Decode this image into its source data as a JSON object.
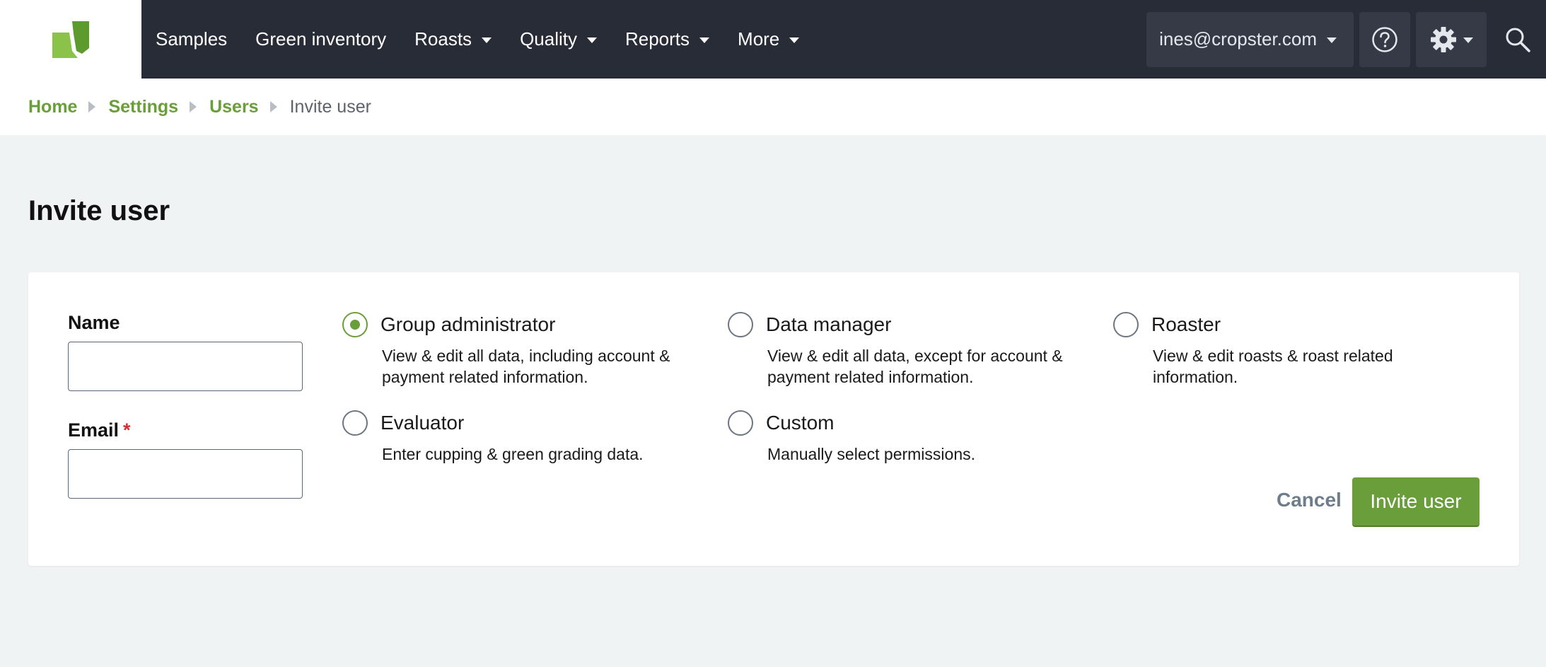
{
  "nav": {
    "items": [
      {
        "label": "Samples",
        "has_dropdown": false
      },
      {
        "label": "Green inventory",
        "has_dropdown": false
      },
      {
        "label": "Roasts",
        "has_dropdown": true
      },
      {
        "label": "Quality",
        "has_dropdown": true
      },
      {
        "label": "Reports",
        "has_dropdown": true
      },
      {
        "label": "More",
        "has_dropdown": true
      }
    ],
    "user_email": "ines@cropster.com"
  },
  "breadcrumb": {
    "home": "Home",
    "settings": "Settings",
    "users": "Users",
    "current": "Invite user"
  },
  "page": {
    "title": "Invite user"
  },
  "form": {
    "name_label": "Name",
    "name_value": "",
    "email_label": "Email",
    "email_required_mark": "*",
    "email_value": "",
    "roles": [
      {
        "title": "Group administrator",
        "desc": "View & edit all data, including account & payment related information.",
        "checked": true
      },
      {
        "title": "Data manager",
        "desc": "View & edit all data, except for account & payment related information.",
        "checked": false
      },
      {
        "title": "Roaster",
        "desc": "View & edit roasts & roast related information.",
        "checked": false
      },
      {
        "title": "Evaluator",
        "desc": "Enter cupping & green grading data.",
        "checked": false
      },
      {
        "title": "Custom",
        "desc": "Manually select permissions.",
        "checked": false
      }
    ],
    "cancel_label": "Cancel",
    "submit_label": "Invite user"
  },
  "colors": {
    "nav_bg": "#282c36",
    "accent_green": "#6a9e3a",
    "page_bg": "#f0f3f3",
    "required_red": "#d32f2f"
  },
  "icons": [
    "cropster-logo",
    "caret-down-icon",
    "help-icon",
    "gear-icon",
    "search-icon",
    "chevron-right-icon"
  ]
}
